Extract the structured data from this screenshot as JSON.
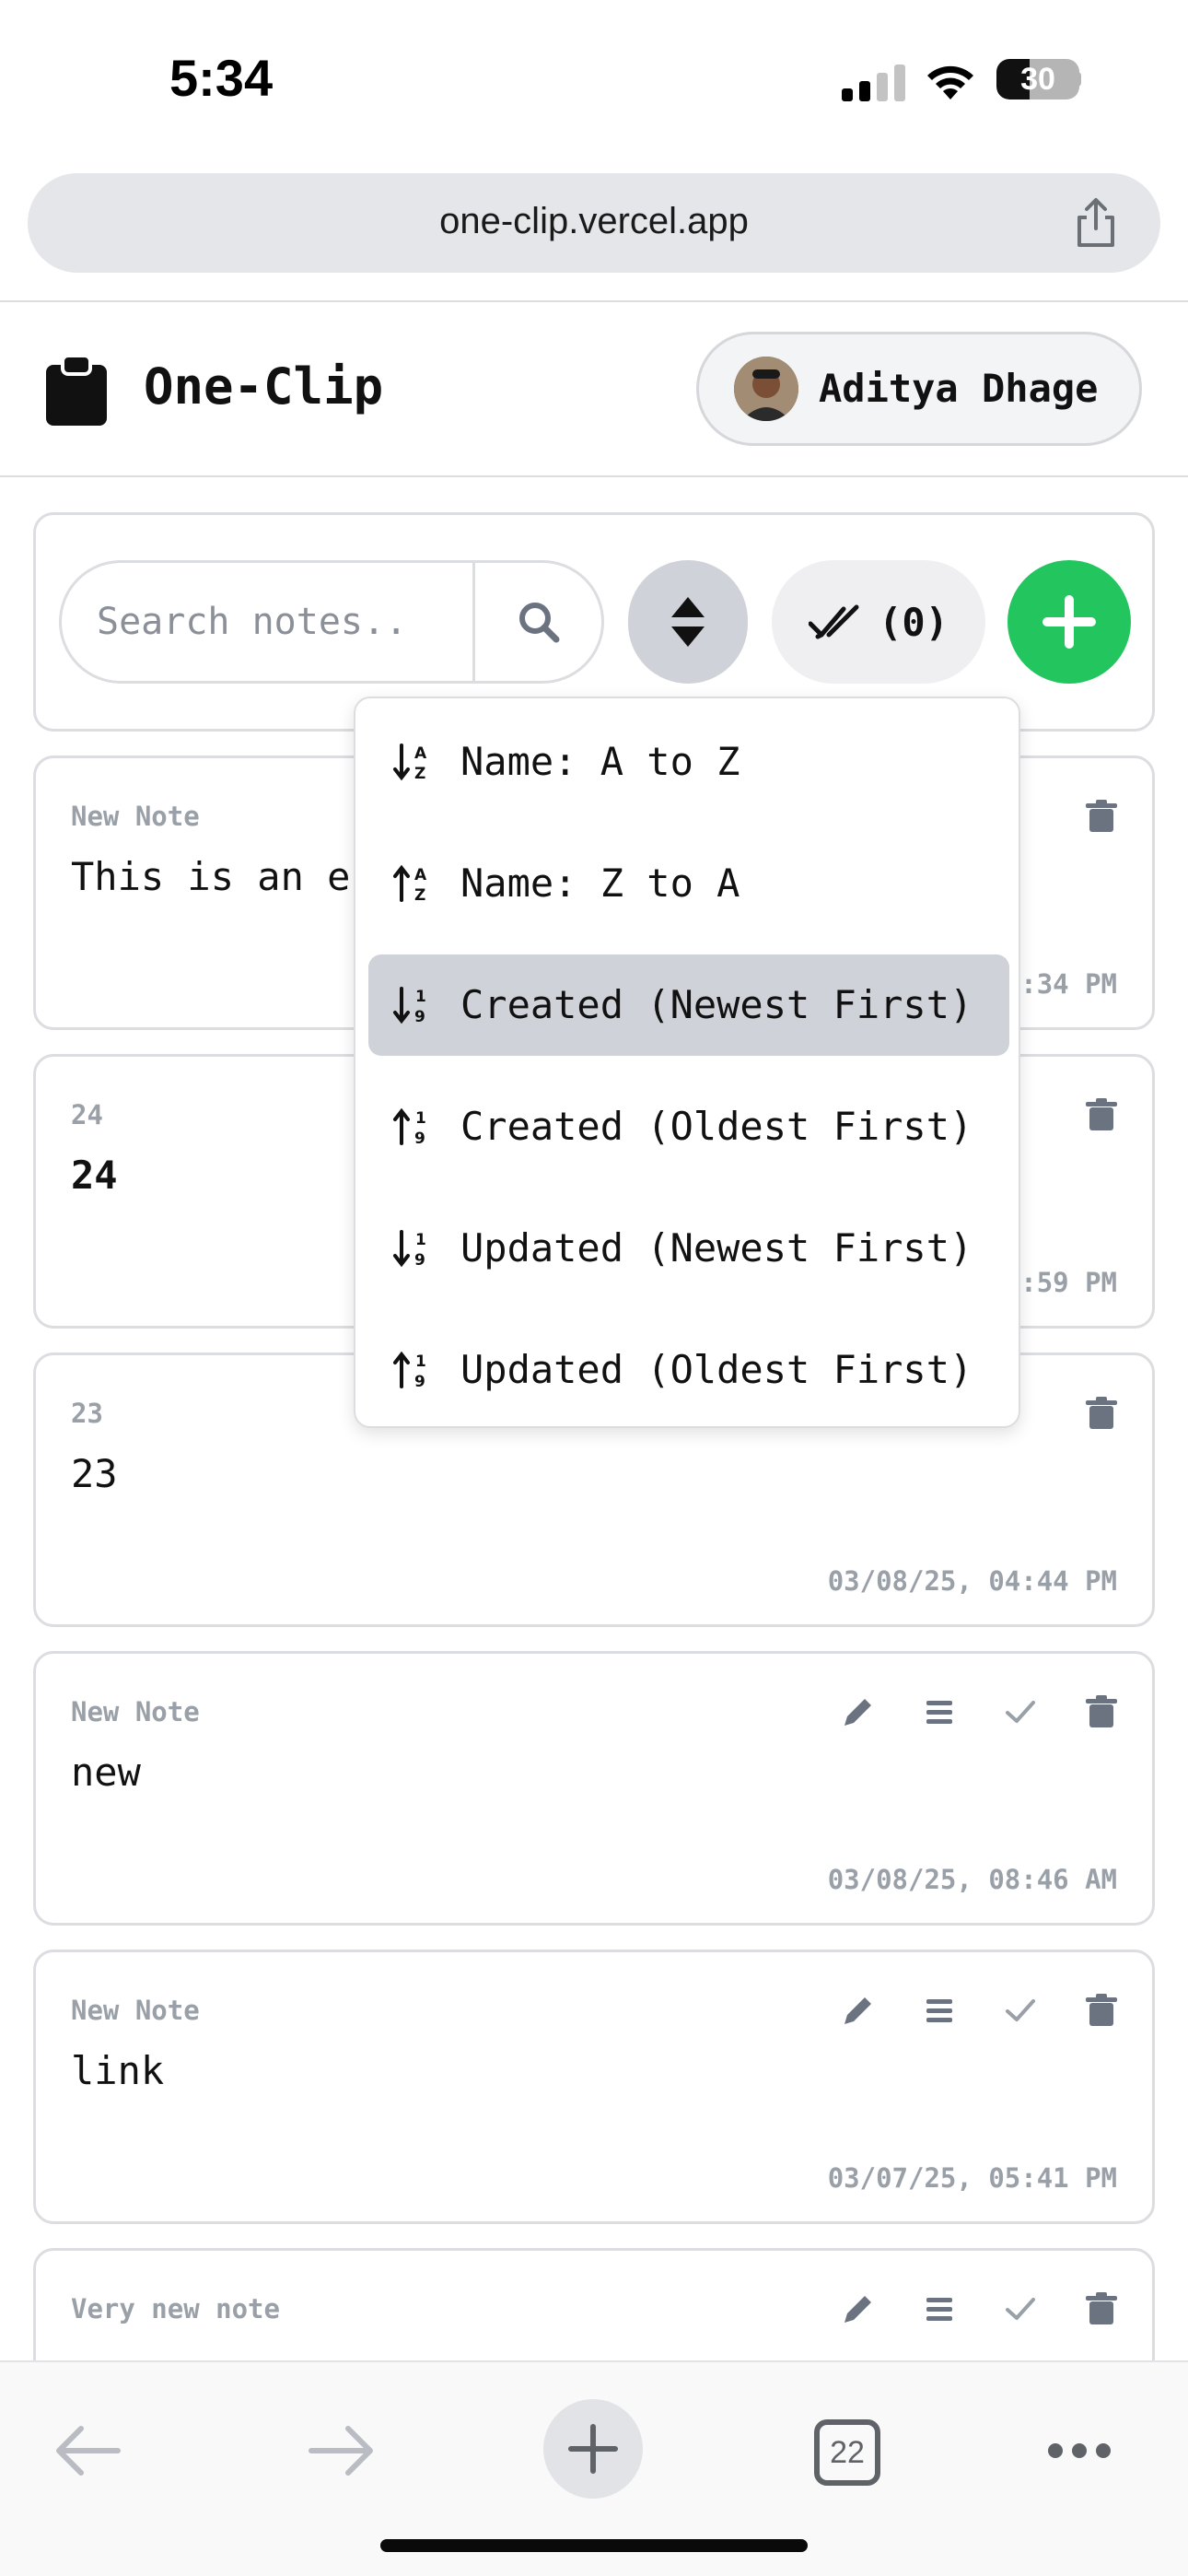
{
  "status_bar": {
    "time": "5:34",
    "battery": "30"
  },
  "browser": {
    "url": "one-clip.vercel.app",
    "tab_count": "22"
  },
  "app": {
    "title": "One-Clip",
    "user_name": "Aditya Dhage"
  },
  "toolbar": {
    "search_placeholder": "Search notes..",
    "selected_count": "(0)"
  },
  "sort_menu": {
    "items": [
      {
        "label": "Name: A to Z",
        "active": false
      },
      {
        "label": "Name: Z to A",
        "active": false
      },
      {
        "label": "Created (Newest First)",
        "active": true
      },
      {
        "label": "Created (Oldest First)",
        "active": false
      },
      {
        "label": "Updated (Newest First)",
        "active": false
      },
      {
        "label": "Updated (Oldest First)",
        "active": false
      }
    ]
  },
  "notes": [
    {
      "title": "New Note",
      "body": "This is an e",
      "date": ":34 PM"
    },
    {
      "title": "24",
      "body": "24",
      "date": ":59 PM"
    },
    {
      "title": "23",
      "body": "23",
      "date": "03/08/25, 04:44 PM"
    },
    {
      "title": "New Note",
      "body": "new",
      "date": "03/08/25, 08:46 AM"
    },
    {
      "title": "New Note",
      "body": "link",
      "date": "03/07/25, 05:41 PM"
    },
    {
      "title": "Very new note",
      "body": "",
      "date": ""
    }
  ],
  "colors": {
    "accent_green": "#22c55e",
    "muted_text": "#9aa0a8",
    "border": "#dcdde0"
  }
}
